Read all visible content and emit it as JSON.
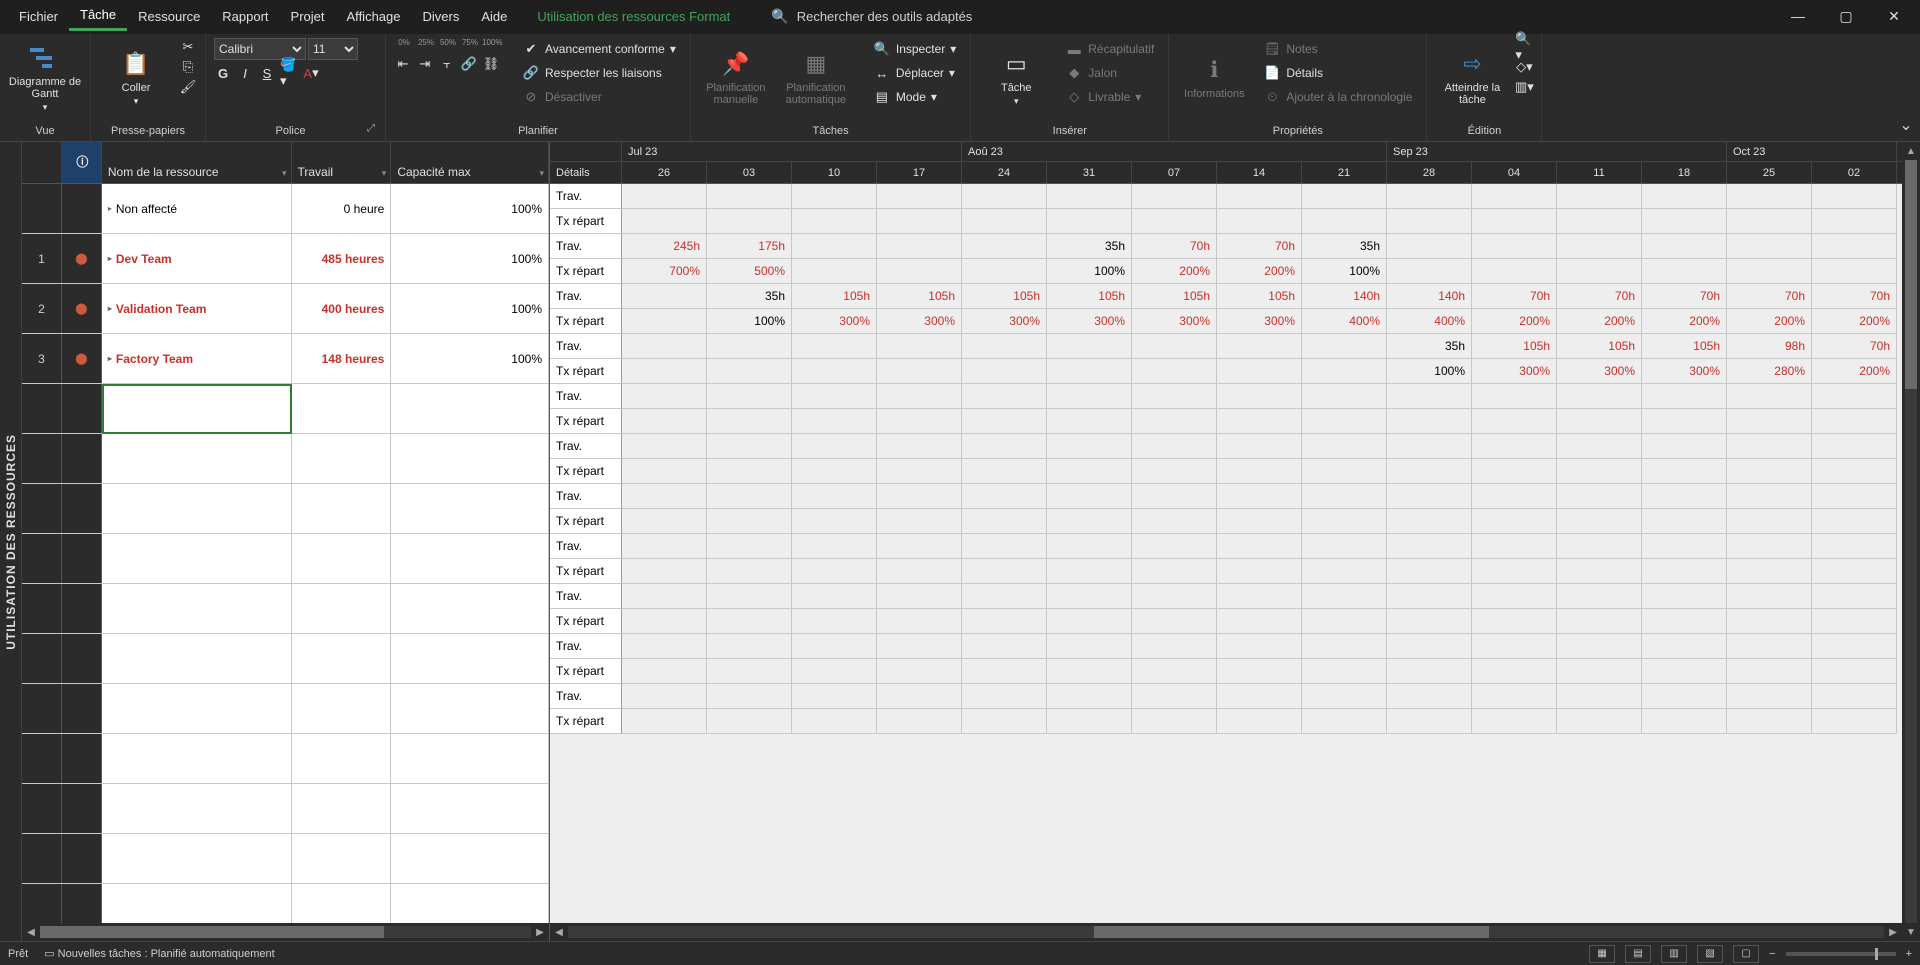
{
  "menu": {
    "tabs": [
      "Fichier",
      "Tâche",
      "Ressource",
      "Rapport",
      "Projet",
      "Affichage",
      "Divers",
      "Aide"
    ],
    "active": "Tâche",
    "context": "Utilisation des ressources Format",
    "search_placeholder": "Rechercher des outils adaptés"
  },
  "ribbon": {
    "vue": {
      "gantt": "Diagramme de Gantt",
      "label": "Vue"
    },
    "clipboard": {
      "paste": "Coller",
      "label": "Presse-papiers"
    },
    "font": {
      "name": "Calibri",
      "size": "11",
      "label": "Police",
      "marks": [
        "0%",
        "25%",
        "50%",
        "75%",
        "100%"
      ]
    },
    "schedule": {
      "track": "Avancement conforme",
      "links": "Respecter les liaisons",
      "disable": "Désactiver",
      "label": "Planifier"
    },
    "tasks": {
      "manual": "Planification manuelle",
      "auto": "Planification automatique",
      "inspect": "Inspecter",
      "move": "Déplacer",
      "mode": "Mode",
      "label": "Tâches"
    },
    "insert": {
      "task": "Tâche",
      "summary": "Récapitulatif",
      "milestone": "Jalon",
      "deliverable": "Livrable",
      "label": "Insérer"
    },
    "props": {
      "info": "Informations",
      "notes": "Notes",
      "details": "Détails",
      "timeline": "Ajouter à la chronologie",
      "label": "Propriétés"
    },
    "edit": {
      "scroll": "Atteindre la tâche",
      "label": "Édition"
    }
  },
  "sidebar_title": "UTILISATION DES RESSOURCES",
  "left": {
    "headers": {
      "name": "Nom de la ressource",
      "work": "Travail",
      "cap": "Capacité max"
    },
    "rows": [
      {
        "num": "",
        "info": "",
        "name": "Non affecté",
        "work": "0 heure",
        "cap": "100%",
        "over": false
      },
      {
        "num": "1",
        "info": "👤",
        "name": "Dev Team",
        "work": "485 heures",
        "cap": "100%",
        "over": true
      },
      {
        "num": "2",
        "info": "👤",
        "name": "Validation Team",
        "work": "400 heures",
        "cap": "100%",
        "over": true
      },
      {
        "num": "3",
        "info": "👤",
        "name": "Factory Team",
        "work": "148 heures",
        "cap": "100%",
        "over": true
      }
    ]
  },
  "right": {
    "months": [
      {
        "label": "Jul 23",
        "span": 4
      },
      {
        "label": "Aoû 23",
        "span": 5
      },
      {
        "label": "Sep 23",
        "span": 4
      },
      {
        "label": "Oct 23",
        "span": 2
      }
    ],
    "details": "Détails",
    "days": [
      "26",
      "03",
      "10",
      "17",
      "24",
      "31",
      "07",
      "14",
      "21",
      "28",
      "04",
      "11",
      "18",
      "25",
      "02"
    ],
    "detail_labels": {
      "trav": "Trav.",
      "tx": "Tx répart"
    },
    "data": [
      {
        "trav": [
          "",
          "",
          "",
          "",
          "",
          "",
          "",
          "",
          "",
          "",
          "",
          "",
          "",
          "",
          ""
        ],
        "tx": [
          "",
          "",
          "",
          "",
          "",
          "",
          "",
          "",
          "",
          "",
          "",
          "",
          "",
          "",
          ""
        ],
        "red": [
          false,
          false,
          false,
          false,
          false,
          false,
          false,
          false,
          false,
          false,
          false,
          false,
          false,
          false,
          false
        ]
      },
      {
        "trav": [
          "245h",
          "175h",
          "",
          "",
          "",
          "35h",
          "70h",
          "70h",
          "35h",
          "",
          "",
          "",
          "",
          "",
          ""
        ],
        "tx": [
          "700%",
          "500%",
          "",
          "",
          "",
          "100%",
          "200%",
          "200%",
          "100%",
          "",
          "",
          "",
          "",
          "",
          ""
        ],
        "red": [
          true,
          true,
          false,
          false,
          false,
          false,
          true,
          true,
          false,
          false,
          false,
          false,
          false,
          false,
          false
        ]
      },
      {
        "trav": [
          "",
          "35h",
          "105h",
          "105h",
          "105h",
          "105h",
          "105h",
          "105h",
          "140h",
          "140h",
          "70h",
          "70h",
          "70h",
          "70h",
          "70h"
        ],
        "tx": [
          "",
          "100%",
          "300%",
          "300%",
          "300%",
          "300%",
          "300%",
          "300%",
          "400%",
          "400%",
          "200%",
          "200%",
          "200%",
          "200%",
          "200%"
        ],
        "red": [
          false,
          false,
          true,
          true,
          true,
          true,
          true,
          true,
          true,
          true,
          true,
          true,
          true,
          true,
          true
        ]
      },
      {
        "trav": [
          "",
          "",
          "",
          "",
          "",
          "",
          "",
          "",
          "",
          "35h",
          "105h",
          "105h",
          "105h",
          "98h",
          "70h"
        ],
        "tx": [
          "",
          "",
          "",
          "",
          "",
          "",
          "",
          "",
          "",
          "100%",
          "300%",
          "300%",
          "300%",
          "280%",
          "200%"
        ],
        "red": [
          false,
          false,
          false,
          false,
          false,
          false,
          false,
          false,
          false,
          false,
          true,
          true,
          true,
          true,
          true
        ]
      }
    ],
    "empty_rows": 14
  },
  "status": {
    "ready": "Prêt",
    "new_tasks": "Nouvelles tâches : Planifié automatiquement"
  }
}
